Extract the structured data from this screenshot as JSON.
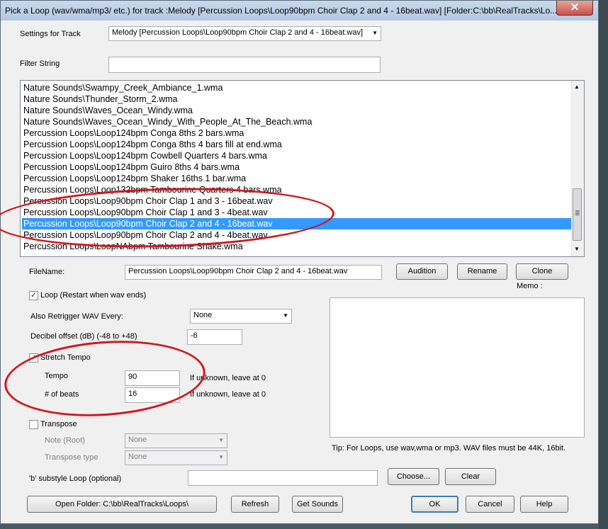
{
  "window": {
    "title": "Pick a Loop (wav/wma/mp3/ etc.) for track :Melody    [Percussion Loops\\Loop90bpm Choir Clap 2 and 4 - 16beat.wav]      [Folder:C:\\bb\\RealTracks\\Lo...",
    "close_glyph": "✕"
  },
  "settings_for_track": {
    "label": "Settings for Track",
    "value": "Melody   [Percussion Loops\\Loop90bpm Choir Clap 2 and 4 - 16beat.wav]"
  },
  "filter": {
    "label": "Filter String",
    "value": ""
  },
  "loop_list": {
    "items": [
      "Nature Sounds\\Swampy_Creek_Ambiance_1.wma",
      "Nature Sounds\\Thunder_Storm_2.wma",
      "Nature Sounds\\Waves_Ocean_Windy.wma",
      "Nature Sounds\\Waves_Ocean_Windy_With_People_At_The_Beach.wma",
      "Percussion Loops\\Loop124bpm Conga 8ths 2 bars.wma",
      "Percussion Loops\\Loop124bpm Conga 8ths 4 bars fill at end.wma",
      "Percussion Loops\\Loop124bpm Cowbell Quarters 4 bars.wma",
      "Percussion Loops\\Loop124bpm Guiro 8ths 4 bars.wma",
      "Percussion Loops\\Loop124bpm Shaker 16ths 1 bar.wma",
      "Percussion Loops\\Loop132bpm Tambourine Quarters 4 bars.wma",
      "Percussion Loops\\Loop90bpm Choir Clap 1 and 3 - 16beat.wav",
      "Percussion Loops\\Loop90bpm Choir Clap 1 and 3 - 4beat.wav",
      "Percussion Loops\\Loop90bpm Choir Clap 2 and 4 - 16beat.wav",
      "Percussion Loops\\Loop90bpm Choir Clap 2 and 4 - 4beat.wav",
      "Percussion Loops\\LoopNAbpm Tambourine Shake.wma"
    ],
    "selected_index": 12
  },
  "filename": {
    "label": "FileName:",
    "value": "Percussion Loops\\Loop90bpm Choir Clap 2 and 4 - 16beat.wav",
    "audition": "Audition",
    "rename": "Rename",
    "clone": "Clone",
    "memo_label": "Memo :"
  },
  "loop_restart": {
    "label": "Loop (Restart when wav ends)",
    "checked": "✓"
  },
  "retrigger": {
    "label": "Also Retrigger WAV Every:",
    "value": "None"
  },
  "decibel": {
    "label": "Decibel offset (dB) (-48 to +48)",
    "value": "-6"
  },
  "stretch_tempo": {
    "label": "Stretch Tempo",
    "checked": "✓"
  },
  "tempo": {
    "label": "Tempo",
    "value": "90",
    "hint": "If unknown, leave at 0"
  },
  "beats": {
    "label": "# of beats",
    "value": "16",
    "hint": "If unknown, leave at 0"
  },
  "transpose": {
    "label": "Transpose",
    "note_label": "Note (Root)",
    "note_value": "None",
    "type_label": "Transpose type",
    "type_value": "None"
  },
  "tip": "Tip: For Loops, use wav,wma or mp3. WAV files must be 44K, 16bit.",
  "b_substyle": {
    "label": "'b' substyle Loop (optional)",
    "value": "",
    "choose": "Choose...",
    "clear": "Clear"
  },
  "bottom": {
    "open_folder": "Open Folder: C:\\bb\\RealTracks\\Loops\\",
    "refresh": "Refresh",
    "get_sounds": "Get Sounds",
    "ok": "OK",
    "cancel": "Cancel",
    "help": "Help"
  },
  "colors": {
    "selection": "#3399ff",
    "annotation": "#d3161f"
  }
}
